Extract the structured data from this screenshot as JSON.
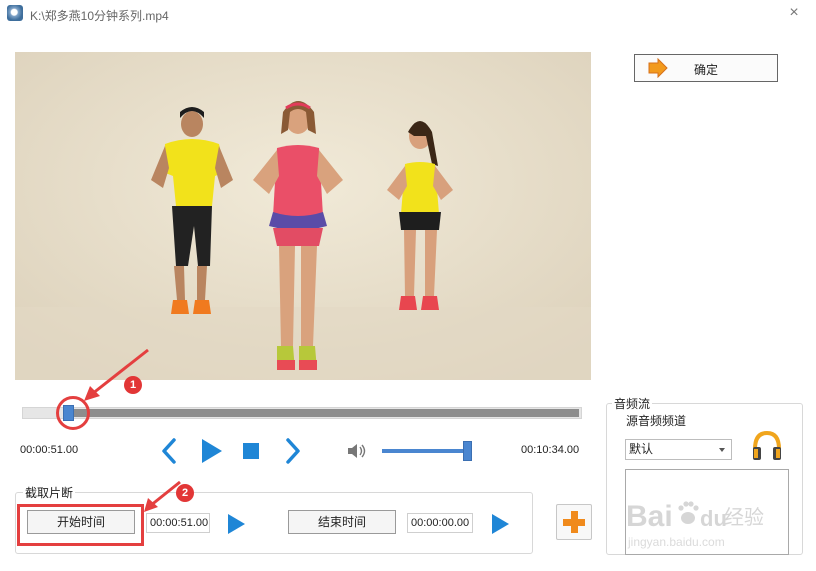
{
  "window": {
    "title": "K:\\郑多燕10分钟系列.mp4",
    "close_glyph": "×"
  },
  "confirm_button": {
    "label": "确定"
  },
  "playback": {
    "current_time": "00:00:51.00",
    "total_time": "00:10:34.00",
    "seek_fraction": 0.08,
    "volume_fraction": 0.94
  },
  "annotations": {
    "badge1": "1",
    "badge2": "2"
  },
  "clip_section": {
    "label": "截取片断",
    "start_button": "开始时间",
    "start_value": "00:00:51.00",
    "end_button": "结束时间",
    "end_value": "00:00:00.00"
  },
  "audio_section": {
    "label": "音频流",
    "source_label": "源音频频道",
    "selected": "默认"
  },
  "watermark": {
    "brand": "Bai",
    "brand2": "du",
    "text": "经验",
    "url": "jingyan.baidu.com"
  },
  "colors": {
    "accent": "#4a86d0",
    "play_blue": "#1f86d6",
    "annotation_red": "#e43f3f",
    "add_orange": "#f08a1c"
  },
  "icons": [
    "arrow-right-icon",
    "prev-icon",
    "play-icon",
    "stop-icon",
    "next-icon",
    "volume-icon",
    "headphones-icon",
    "add-icon"
  ]
}
